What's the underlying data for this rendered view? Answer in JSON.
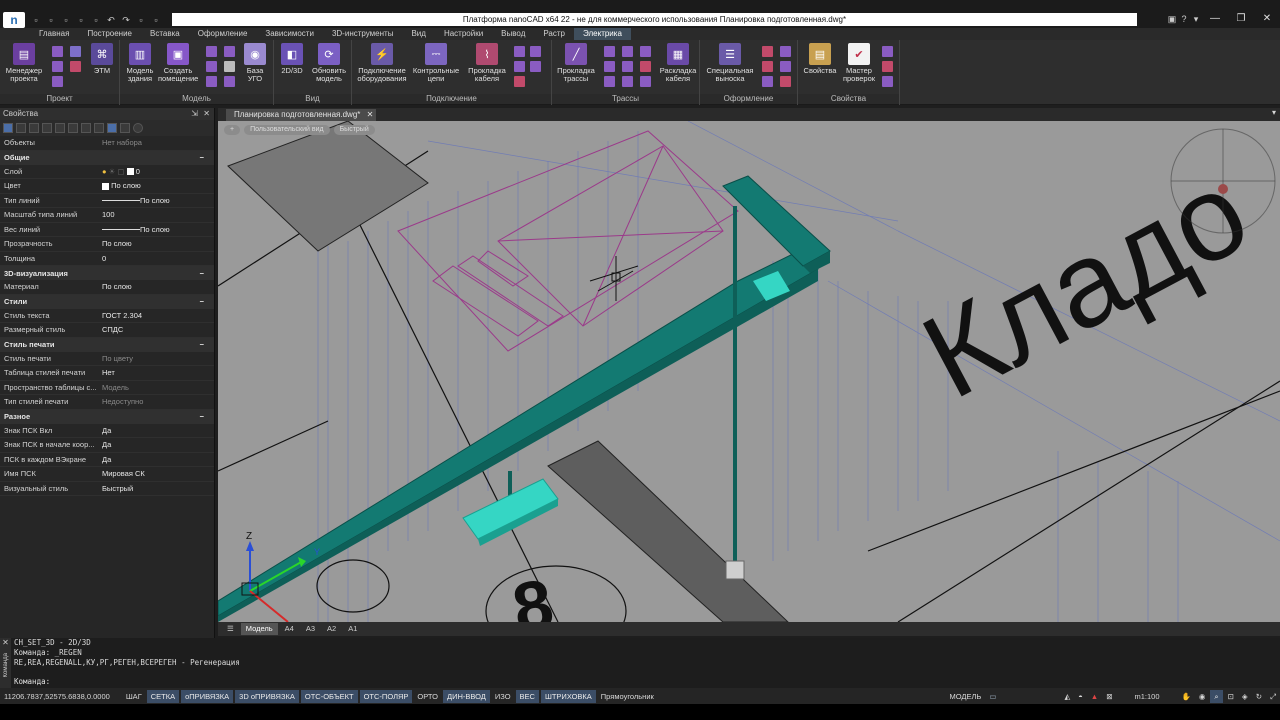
{
  "window": {
    "title": "Платформа nanoCAD x64 22 - не для коммерческого использования Планировка подготовленная.dwg*",
    "logo": "n",
    "controls": [
      "—",
      "❐",
      "✕"
    ],
    "help": [
      "?",
      "▾"
    ]
  },
  "qat": [
    "▫",
    "▫",
    "▫",
    "▫",
    "▫",
    "↶",
    "↷",
    "▫",
    "▫"
  ],
  "ribbon_tabs": [
    {
      "label": "Главная"
    },
    {
      "label": "Построение"
    },
    {
      "label": "Вставка"
    },
    {
      "label": "Оформление"
    },
    {
      "label": "Зависимости"
    },
    {
      "label": "3D-инструменты"
    },
    {
      "label": "Вид"
    },
    {
      "label": "Настройки"
    },
    {
      "label": "Вывод"
    },
    {
      "label": "Растр"
    },
    {
      "label": "Электрика",
      "active": true
    }
  ],
  "ribbon_groups": [
    {
      "label": "Проект",
      "buttons": [
        "Менеджер\nпроекта",
        "ЭТМ"
      ]
    },
    {
      "label": "Модель",
      "buttons": [
        "Модель\nздания",
        "Создать\nпомещение",
        "База\nУГО"
      ]
    },
    {
      "label": "Вид",
      "buttons": [
        "2D/3D",
        "Обновить\nмодель"
      ]
    },
    {
      "label": "Подключение",
      "buttons": [
        "Подключение\nоборудования",
        "Контрольные\nцепи",
        "Прокладка\nкабеля"
      ]
    },
    {
      "label": "Трассы",
      "buttons": [
        "Прокладка\nтрассы",
        "Раскладка\nкабеля"
      ]
    },
    {
      "label": "Оформление",
      "buttons": [
        "Специальная\nвыноска"
      ]
    },
    {
      "label": "Свойства",
      "buttons": [
        "Свойства",
        "Мастер\nпроверок"
      ]
    }
  ],
  "properties": {
    "title": "Свойства",
    "rows_top": [
      {
        "key": "Объекты",
        "val": "Нет набора",
        "dim": true
      }
    ],
    "sections": [
      {
        "title": "Общие",
        "rows": [
          {
            "key": "Слой",
            "val": "0"
          },
          {
            "key": "Цвет",
            "val": "По слою"
          },
          {
            "key": "Тип линий",
            "val": "По слою"
          },
          {
            "key": "Масштаб типа линий",
            "val": "100"
          },
          {
            "key": "Вес линий",
            "val": "По слою"
          },
          {
            "key": "Прозрачность",
            "val": "По слою"
          },
          {
            "key": "Толщина",
            "val": "0"
          }
        ]
      },
      {
        "title": "3D-визуализация",
        "rows": [
          {
            "key": "Материал",
            "val": "По слою"
          }
        ]
      },
      {
        "title": "Стили",
        "rows": [
          {
            "key": "Стиль текста",
            "val": "ГОСТ 2.304"
          },
          {
            "key": "Размерный стиль",
            "val": "СПДС"
          }
        ]
      },
      {
        "title": "Стиль печати",
        "rows": [
          {
            "key": "Стиль печати",
            "val": "По цвету",
            "dim": true
          },
          {
            "key": "Таблица стилей печати",
            "val": "Нет"
          },
          {
            "key": "Пространство таблицы с...",
            "val": "Модель",
            "dim": true
          },
          {
            "key": "Тип стилей печати",
            "val": "Недоступно",
            "dim": true
          }
        ]
      },
      {
        "title": "Разное",
        "rows": [
          {
            "key": "Знак ПСК Вкл",
            "val": "Да"
          },
          {
            "key": "Знак ПСК в начале коор...",
            "val": "Да"
          },
          {
            "key": "ПСК в каждом ВЭкране",
            "val": "Да"
          },
          {
            "key": "Имя ПСК",
            "val": "Мировая СК"
          },
          {
            "key": "Визуальный стиль",
            "val": "Быстрый"
          }
        ]
      }
    ]
  },
  "document": {
    "tab": "Планировка подготовленная.dwg*",
    "view_buttons": [
      "+",
      "Пользовательский вид",
      "Быстрый"
    ],
    "room_text": "Кладо",
    "room_number": "8",
    "axes": {
      "z": "Z",
      "y": "Y"
    },
    "layout_tabs": [
      {
        "label": "Модель",
        "active": true
      },
      {
        "label": "A4"
      },
      {
        "label": "A3"
      },
      {
        "label": "A2"
      },
      {
        "label": "A1"
      }
    ]
  },
  "command": {
    "side_label": "Команда",
    "lines": [
      "CH_SET_3D - 2D/3D",
      "Команда: _REGEN",
      "RE,REA,REGENALL,КУ,РГ,РЕГЕН,ВСЕРЕГЕН - Регенерация"
    ],
    "prompt": "Команда:"
  },
  "status": {
    "coords": "11206.7837,52575.6838,0.0000",
    "toggles": [
      {
        "label": "ШАГ",
        "on": false
      },
      {
        "label": "СЕТКА",
        "on": true
      },
      {
        "label": "оПРИВЯЗКА",
        "on": true
      },
      {
        "label": "3D оПРИВЯЗКА",
        "on": true
      },
      {
        "label": "ОТС-ОБЪЕКТ",
        "on": true
      },
      {
        "label": "ОТС-ПОЛЯР",
        "on": true
      },
      {
        "label": "ОРТО",
        "on": false
      },
      {
        "label": "ДИН-ВВОД",
        "on": true
      },
      {
        "label": "ИЗО",
        "on": false
      },
      {
        "label": "ВЕС",
        "on": true
      },
      {
        "label": "ШТРИХОВКА",
        "on": true
      },
      {
        "label": "Прямоугольник",
        "on": false
      }
    ],
    "space": "МОДЕЛЬ",
    "scale": "m1:100"
  },
  "colors": {
    "viewport_bg": "#9a9a9a",
    "tray": "#137a72",
    "tray_highlight": "#35d6c4",
    "active_tab": "#3f4e5c",
    "toggle_on": "#3b4d66"
  }
}
